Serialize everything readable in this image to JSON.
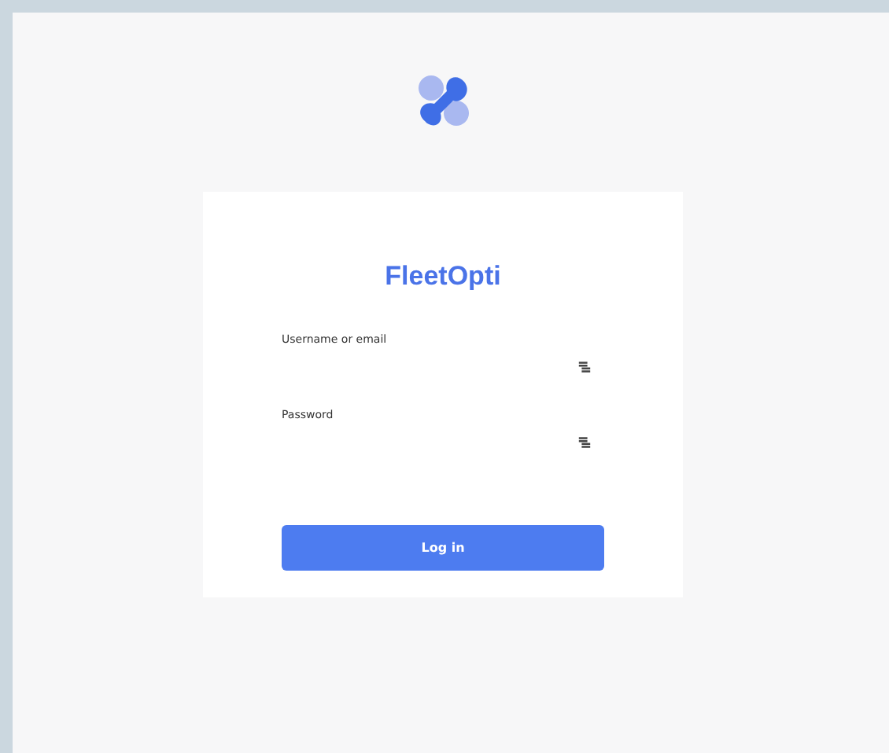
{
  "app": {
    "title": "FleetOpti"
  },
  "fields": [
    {
      "label": "Username or email"
    },
    {
      "label": "Password"
    }
  ],
  "button": {
    "label": "Log in"
  }
}
